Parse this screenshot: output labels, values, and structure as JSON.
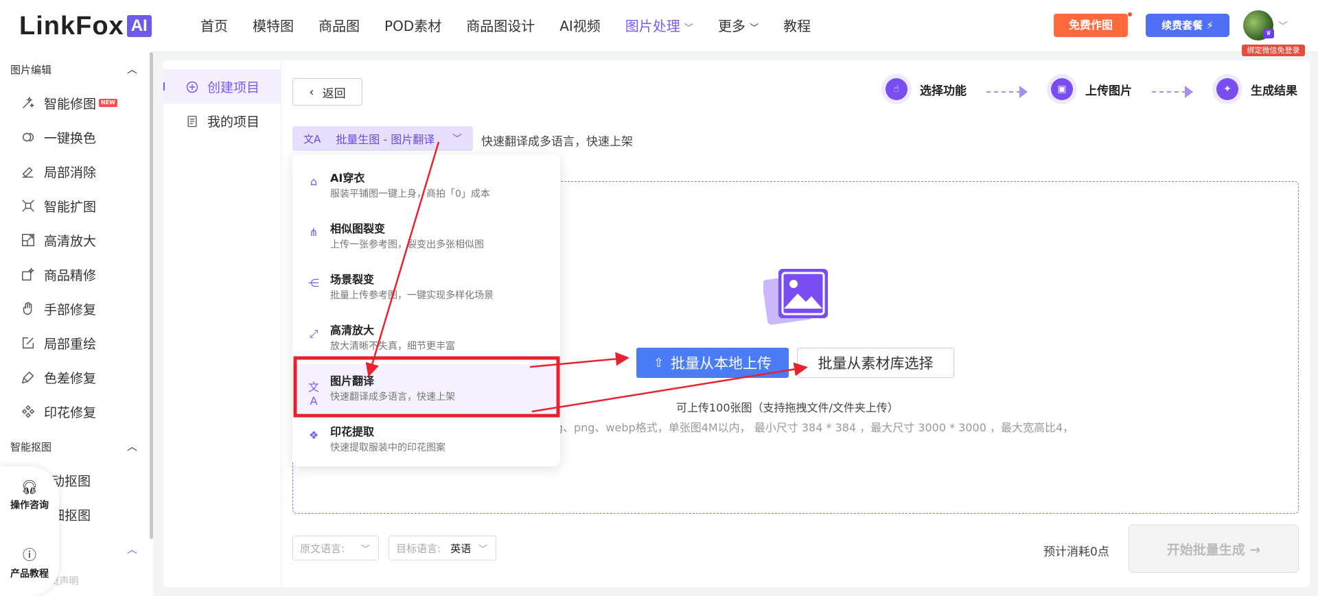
{
  "header": {
    "logo_text": "LinkFox",
    "logo_ai": "AI",
    "nav": [
      {
        "label": "首页"
      },
      {
        "label": "模特图"
      },
      {
        "label": "商品图"
      },
      {
        "label": "POD素材"
      },
      {
        "label": "商品图设计"
      },
      {
        "label": "AI视频"
      },
      {
        "label": "图片处理"
      },
      {
        "label": "更多"
      },
      {
        "label": "教程"
      }
    ],
    "free_btn": "免费作图",
    "renew_btn": "续费套餐 ⚡",
    "avatar_tag": "绑定微信免登录"
  },
  "sidebar": {
    "group1": "图片编辑",
    "items": [
      {
        "label": "智能修图",
        "icon": "magic-wand-icon",
        "badge": "NEW"
      },
      {
        "label": "一键换色",
        "icon": "color-swap-icon"
      },
      {
        "label": "局部消除",
        "icon": "eraser-icon"
      },
      {
        "label": "智能扩图",
        "icon": "expand-icon"
      },
      {
        "label": "高清放大",
        "icon": "upscale-icon"
      },
      {
        "label": "商品精修",
        "icon": "retouch-icon"
      },
      {
        "label": "手部修复",
        "icon": "hand-icon"
      },
      {
        "label": "局部重绘",
        "icon": "edit-icon"
      },
      {
        "label": "色差修复",
        "icon": "brush-icon"
      },
      {
        "label": "印花修复",
        "icon": "pattern-icon"
      }
    ],
    "group2": "智能抠图",
    "items2": [
      {
        "label": "动抠图"
      },
      {
        "label": "细抠图"
      }
    ],
    "footer": "免责声明"
  },
  "float_help": {
    "consult": "操作咨询",
    "tutorial": "产品教程"
  },
  "subnav": {
    "create": "创建项目",
    "mine": "我的项目"
  },
  "main": {
    "back": "返回",
    "steps": [
      {
        "label": "选择功能"
      },
      {
        "label": "上传图片"
      },
      {
        "label": "生成结果"
      }
    ],
    "mode_select": "批量生图 - 图片翻译",
    "mode_desc": "快速翻译成多语言，快速上架",
    "upload_local": "批量从本地上传",
    "upload_lib": "批量从素材库选择",
    "hint1": "可上传100张图（支持拖拽文件/文件夹上传）",
    "hint2": "eg、png、webp格式，单张图4M以内， 最小尺寸 384 * 384 ，最大尺寸 3000 * 3000 ，最大宽高比4，",
    "source_lang_label": "原文语言:",
    "source_lang_value": "",
    "target_lang_label": "目标语言:",
    "target_lang_value": "英语",
    "cost": "预计消耗0点",
    "start": "开始批量生成 →"
  },
  "dropdown": [
    {
      "title": "AI穿衣",
      "desc": "服装平铺图一键上身，商拍「0」成本",
      "icon": "shirt-icon"
    },
    {
      "title": "相似图裂变",
      "desc": "上传一张参考图，裂变出多张相似图",
      "icon": "share-icon"
    },
    {
      "title": "场景裂变",
      "desc": "批量上传参考图，一键实现多样化场景",
      "icon": "branch-icon"
    },
    {
      "title": "高清放大",
      "desc": "放大清晰不失真，细节更丰富",
      "icon": "upscale-icon"
    },
    {
      "title": "图片翻译",
      "desc": "快速翻译成多语言，快速上架",
      "icon": "translate-icon"
    },
    {
      "title": "印花提取",
      "desc": "快速提取服装中的印花图案",
      "icon": "pattern-icon"
    }
  ],
  "colors": {
    "accent": "#7a5af8",
    "annotation": "#e8222c",
    "upload": "#4b7cf8"
  }
}
